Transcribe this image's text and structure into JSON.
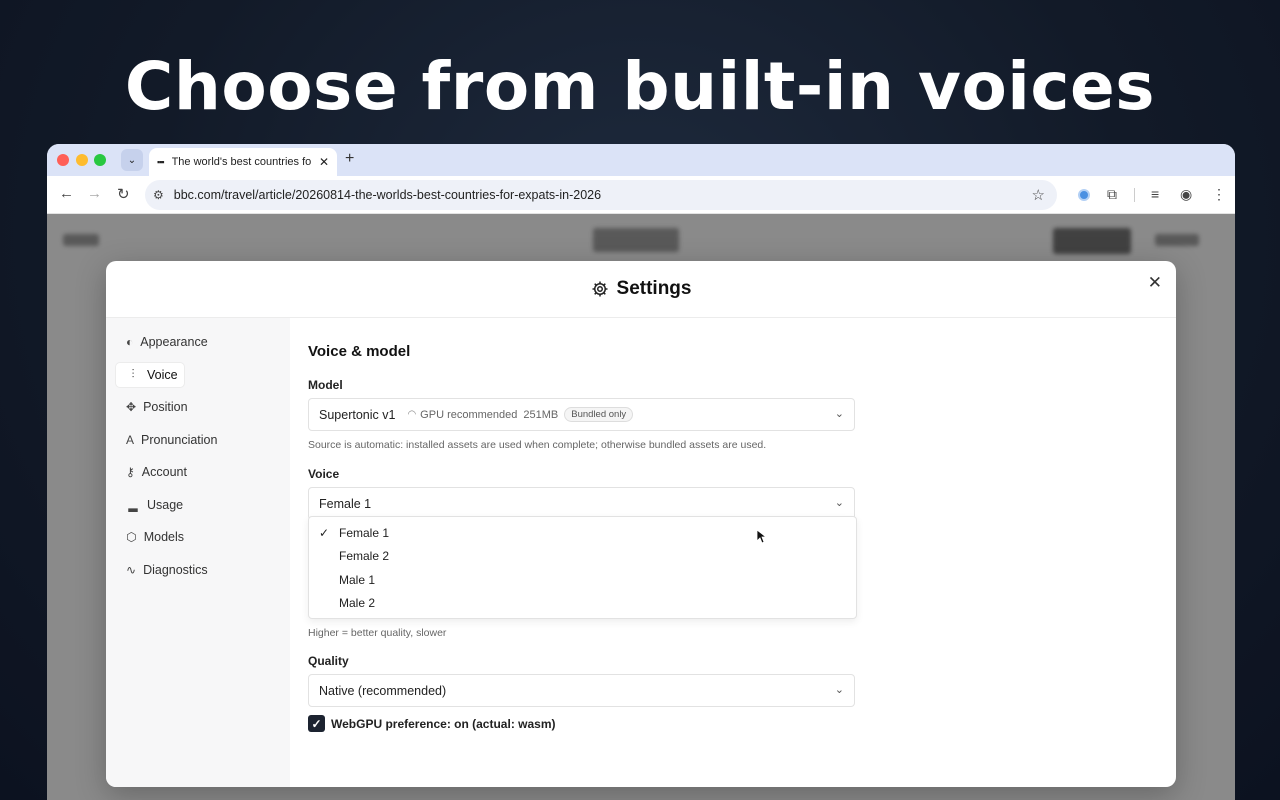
{
  "headline": "Choose from built-in voices",
  "browser": {
    "tab_title": "The world's best countries fo",
    "url": "bbc.com/travel/article/20260814-the-worlds-best-countries-for-expats-in-2026"
  },
  "modal": {
    "title": "Settings",
    "sidebar": [
      {
        "label": "Appearance",
        "icon": "palette-icon"
      },
      {
        "label": "Voice",
        "icon": "waveform-icon"
      },
      {
        "label": "Position",
        "icon": "move-icon"
      },
      {
        "label": "Pronunciation",
        "icon": "pronunciation-icon"
      },
      {
        "label": "Account",
        "icon": "key-icon"
      },
      {
        "label": "Usage",
        "icon": "bar-chart-icon"
      },
      {
        "label": "Models",
        "icon": "cube-icon"
      },
      {
        "label": "Diagnostics",
        "icon": "activity-icon"
      }
    ],
    "active_section": "Voice",
    "section_title": "Voice & model",
    "model": {
      "label": "Model",
      "value": "Supertonic v1",
      "gpu_text": "GPU recommended",
      "size": "251MB",
      "badge": "Bundled only",
      "hint": "Source is automatic: installed assets are used when complete; otherwise bundled assets are used."
    },
    "voice": {
      "label": "Voice",
      "value": "Female 1",
      "options": [
        "Female 1",
        "Female 2",
        "Male 1",
        "Male 2"
      ],
      "selected": "Female 1"
    },
    "steps_hint": "Higher = better quality, slower",
    "quality": {
      "label": "Quality",
      "value": "Native (recommended)"
    },
    "webgpu": {
      "label": "WebGPU preference: on (actual: wasm)",
      "checked": true
    }
  }
}
